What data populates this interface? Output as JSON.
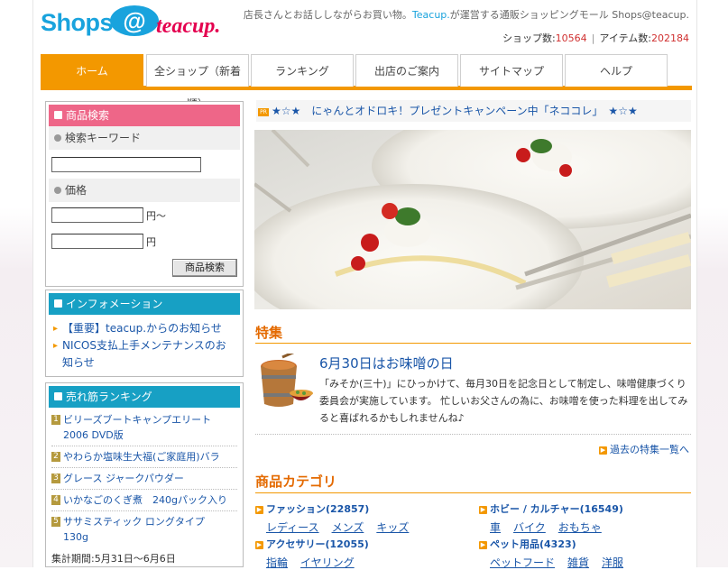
{
  "header": {
    "logo_text_shops": "Shops",
    "logo_text_at": "@",
    "logo_text_teacup": "teacup.",
    "tagline_pre": "店長さんとお話ししながらお買い物。",
    "tagline_brand": "Teacup.",
    "tagline_post": "が運営する通販ショッピングモール Shops@teacup.",
    "shop_count_label": "ショップ数:",
    "shop_count": "10564",
    "sep": "|",
    "item_count_label": "アイテム数:",
    "item_count": "202184"
  },
  "nav": {
    "tabs": [
      {
        "label": "ホーム"
      },
      {
        "label": "全ショップ（新着順）"
      },
      {
        "label": "ランキング"
      },
      {
        "label": "出店のご案内"
      },
      {
        "label": "サイトマップ"
      },
      {
        "label": "ヘルプ"
      }
    ]
  },
  "search": {
    "title": "商品検索",
    "keyword_label": "検索キーワード",
    "keyword_value": "",
    "price_label": "価格",
    "price_min_value": "",
    "price_max_value": "",
    "yen_from": "円〜",
    "yen": "円",
    "button": "商品検索"
  },
  "info": {
    "title": "インフォメーション",
    "items": [
      {
        "text": "【重要】teacup.からのお知らせ"
      },
      {
        "text": "NICOS支払上手メンテナンスのお知らせ"
      }
    ]
  },
  "ranking": {
    "title": "売れ筋ランキング",
    "items": [
      {
        "num": "1",
        "text": "ビリーズブートキャンプエリート 2006 DVD版"
      },
      {
        "num": "2",
        "text": "やわらか塩味生大福(ご家庭用)バラ"
      },
      {
        "num": "3",
        "text": "グレース ジャークパウダー"
      },
      {
        "num": "4",
        "text": "いかなごのくぎ煮　240gパック入り"
      },
      {
        "num": "5",
        "text": "ササミスティック ロングタイプ　130g"
      }
    ],
    "period": "集計期間:5月31日〜6月6日"
  },
  "pr": {
    "badge": "PR",
    "text": "★☆★　にゃんとオドロキ！プレゼントキャンペーン中「ネココレ」　★☆★"
  },
  "tokushu": {
    "heading": "特集",
    "title": "6月30日はお味噌の日",
    "text": "「みそか(三十)」にひっかけて、毎月30日を記念日として制定し、味噌健康づくり委員会が実施しています。 忙しいお父さんの為に、お味噌を使った料理を出してみると喜ばれるかもしれませんね♪",
    "more": "過去の特集一覧へ"
  },
  "categories": {
    "heading": "商品カテゴリ",
    "items": [
      {
        "name": "ファッション(22857)",
        "subs": [
          "レディース",
          "メンズ",
          "キッズ"
        ]
      },
      {
        "name": "ホビー / カルチャー(16549)",
        "subs": [
          "車",
          "バイク",
          "おもちゃ"
        ]
      },
      {
        "name": "アクセサリー(12055)",
        "subs": [
          "指輪",
          "イヤリング"
        ]
      },
      {
        "name": "ペット用品(4323)",
        "subs": [
          "ペットフード",
          "雑貨",
          "洋服"
        ]
      }
    ]
  },
  "colors": {
    "accent": "#f39800",
    "link": "#1a56a8",
    "pink": "#ee6688",
    "teal": "#17a0c4"
  }
}
